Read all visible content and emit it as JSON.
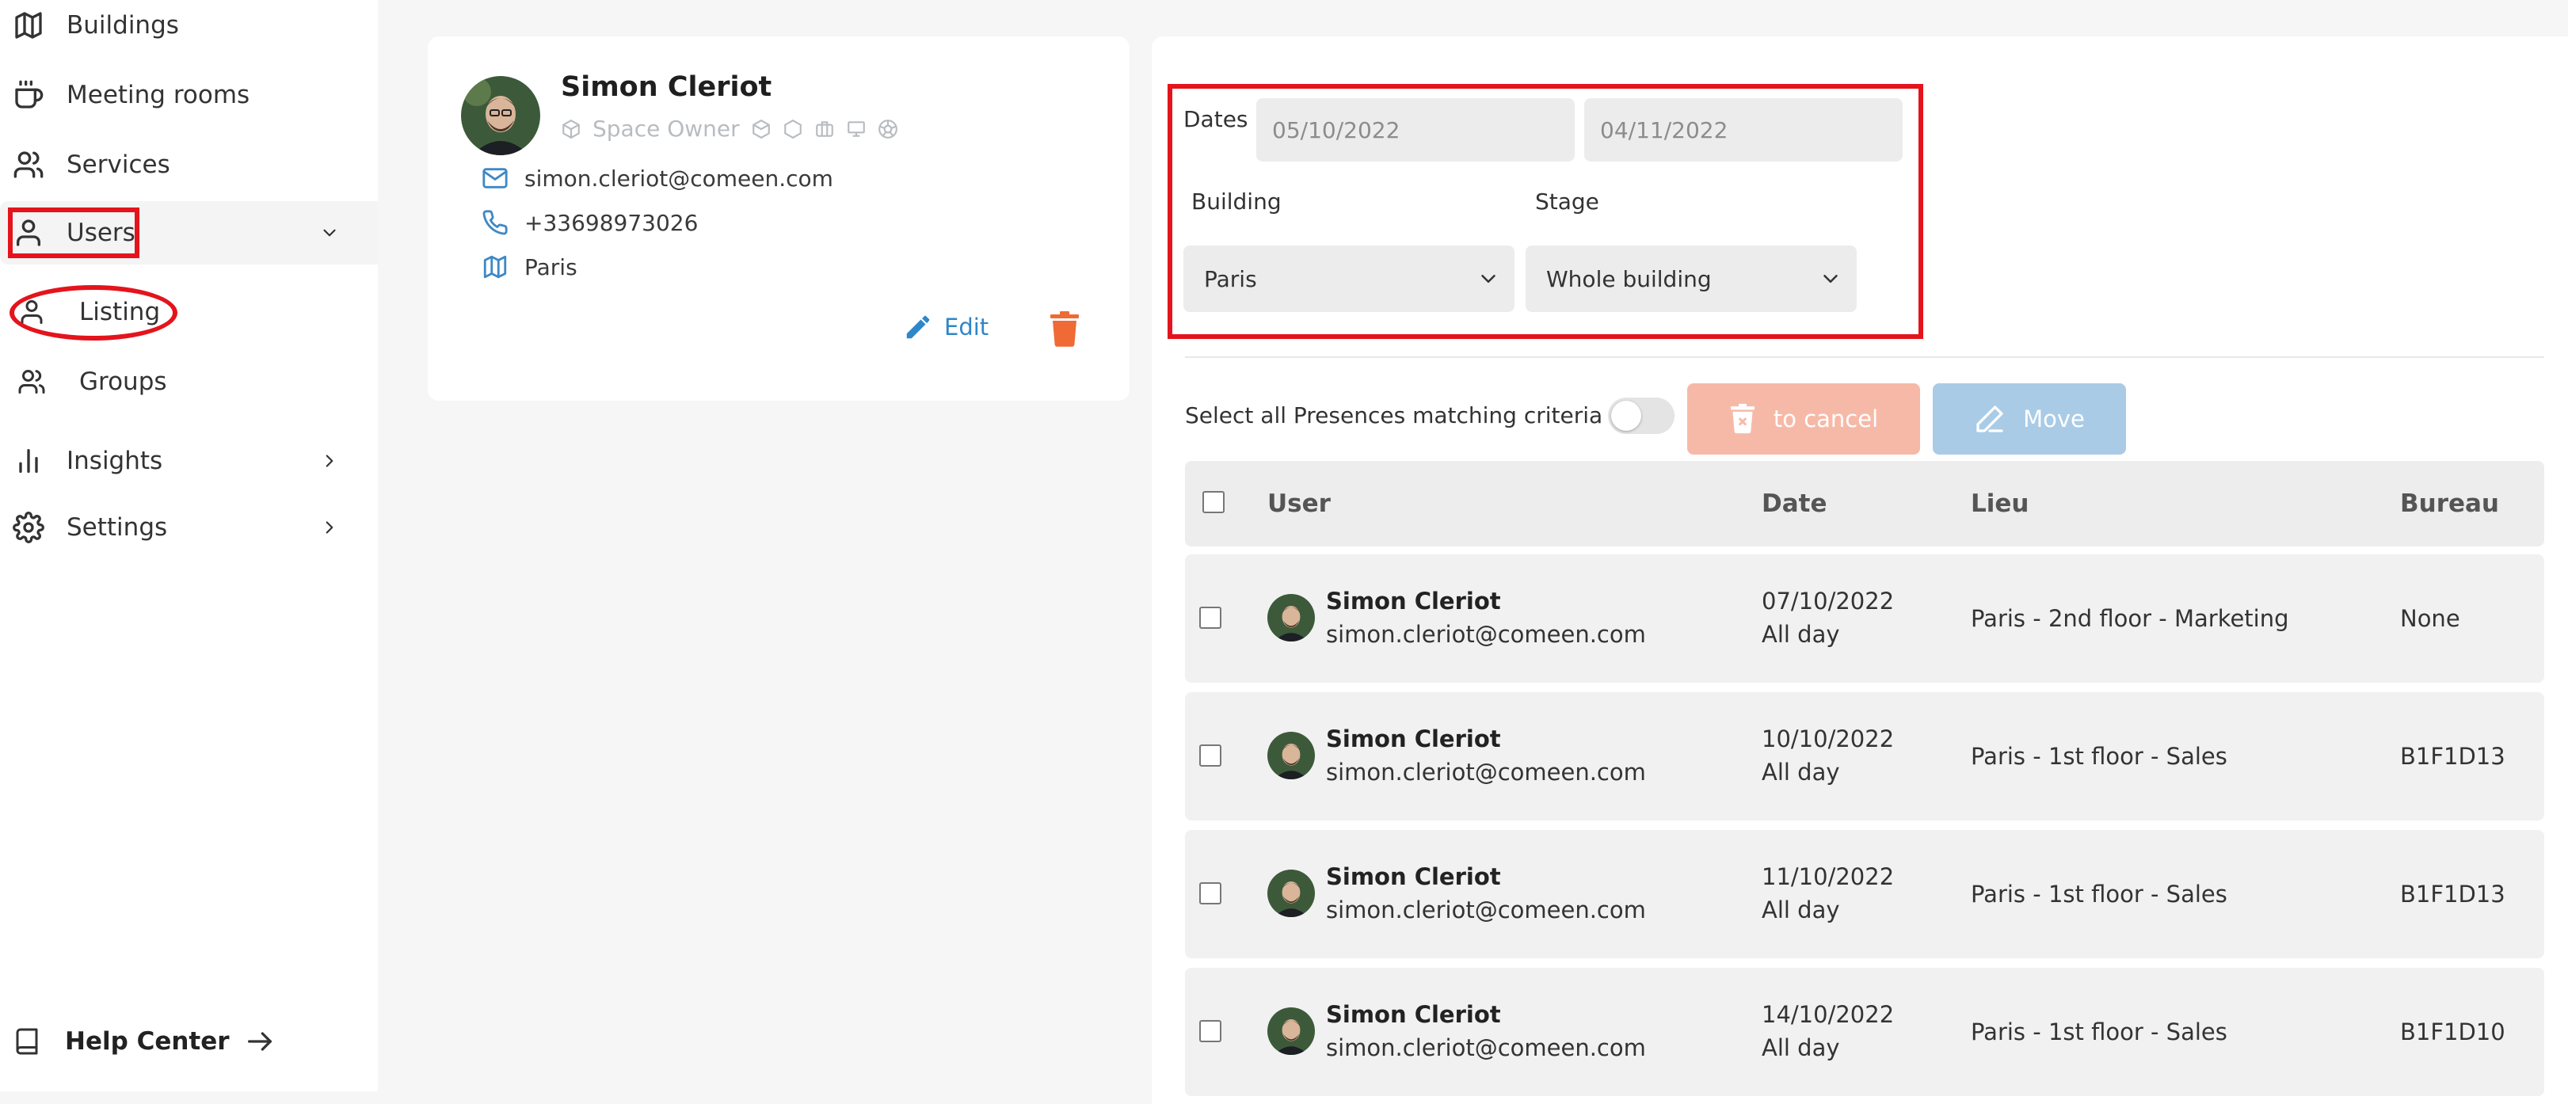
{
  "sidebar": {
    "items": [
      {
        "label": "Buildings"
      },
      {
        "label": "Meeting rooms"
      },
      {
        "label": "Services"
      },
      {
        "label": "Users"
      },
      {
        "label": "Listing"
      },
      {
        "label": "Groups"
      },
      {
        "label": "Insights"
      },
      {
        "label": "Settings"
      }
    ],
    "help_label": "Help Center"
  },
  "profile": {
    "name": "Simon Cleriot",
    "role": "Space Owner",
    "email": "simon.cleriot@comeen.com",
    "phone": "+33698973026",
    "city": "Paris",
    "edit_label": "Edit"
  },
  "filters": {
    "dates_label": "Dates",
    "date_from": "05/10/2022",
    "date_to": "04/11/2022",
    "building_label": "Building",
    "building_value": "Paris",
    "stage_label": "Stage",
    "stage_value": "Whole building"
  },
  "actions": {
    "select_all_label": "Select all Presences matching criteria",
    "cancel_label": "to cancel",
    "move_label": "Move"
  },
  "table": {
    "headers": [
      "User",
      "Date",
      "Lieu",
      "Bureau"
    ],
    "rows": [
      {
        "name": "Simon Cleriot",
        "email": "simon.cleriot@comeen.com",
        "date": "07/10/2022",
        "time": "All day",
        "place": "Paris - 2nd floor - Marketing",
        "desk": "None"
      },
      {
        "name": "Simon Cleriot",
        "email": "simon.cleriot@comeen.com",
        "date": "10/10/2022",
        "time": "All day",
        "place": "Paris - 1st floor - Sales",
        "desk": "B1F1D13"
      },
      {
        "name": "Simon Cleriot",
        "email": "simon.cleriot@comeen.com",
        "date": "11/10/2022",
        "time": "All day",
        "place": "Paris - 1st floor - Sales",
        "desk": "B1F1D13"
      },
      {
        "name": "Simon Cleriot",
        "email": "simon.cleriot@comeen.com",
        "date": "14/10/2022",
        "time": "All day",
        "place": "Paris - 1st floor - Sales",
        "desk": "B1F1D10"
      }
    ]
  },
  "colors": {
    "accent": "#2f86c8",
    "annotation_red": "#e4141c",
    "cancel_bg": "#f7b9a7",
    "move_bg": "#a9cbe6"
  }
}
